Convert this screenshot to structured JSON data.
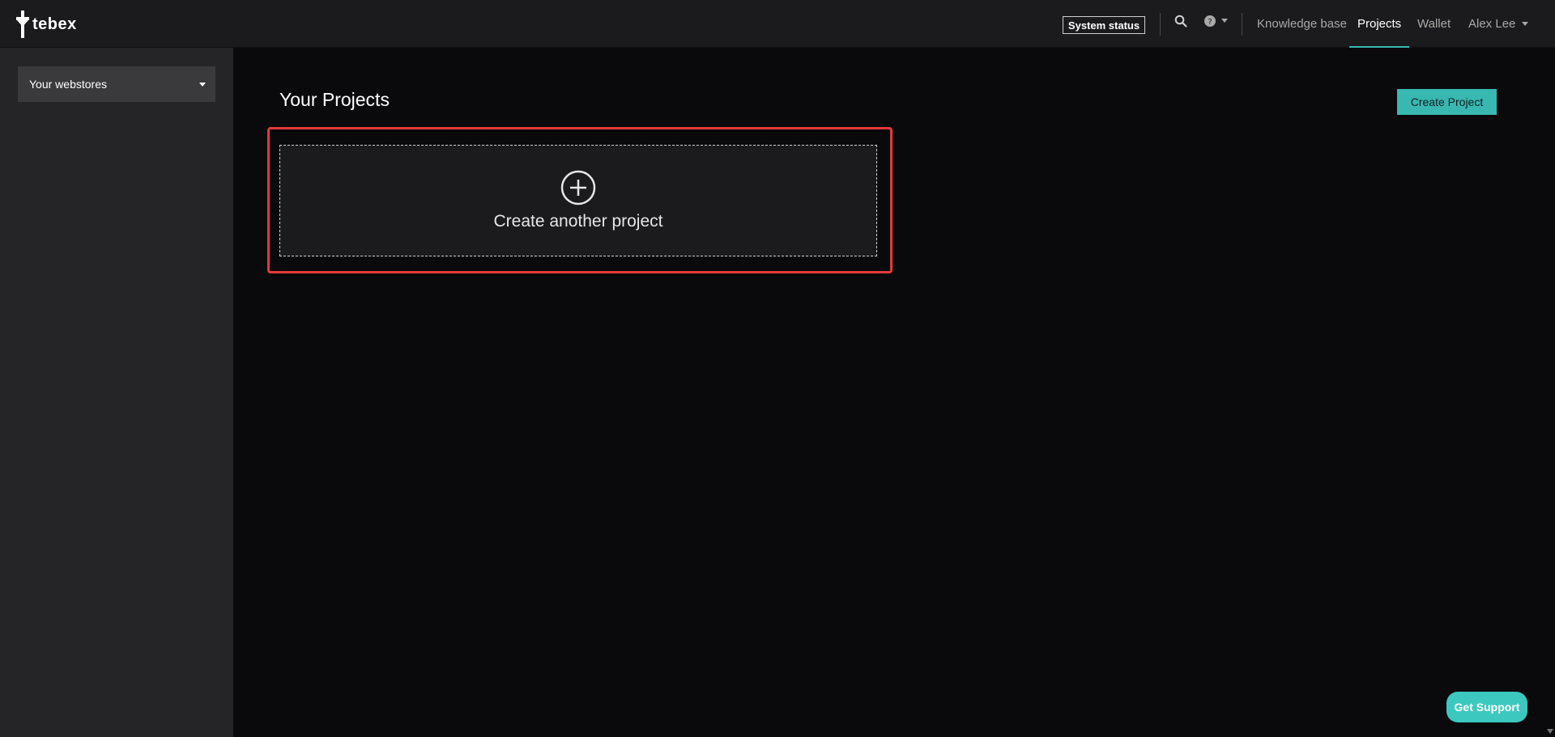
{
  "brand": {
    "name": "tebex"
  },
  "header": {
    "system_status": "System status",
    "nav": {
      "knowledge_base": "Knowledge base",
      "projects": "Projects",
      "wallet": "Wallet",
      "user": "Alex Lee"
    },
    "active_nav": "projects"
  },
  "sidebar": {
    "webstores_select": "Your webstores"
  },
  "main": {
    "title": "Your Projects",
    "create_button": "Create Project",
    "create_card_label": "Create another project"
  },
  "support": {
    "label": "Get Support"
  },
  "colors": {
    "accent": "#38b8b1",
    "highlight": "#e5393a"
  }
}
